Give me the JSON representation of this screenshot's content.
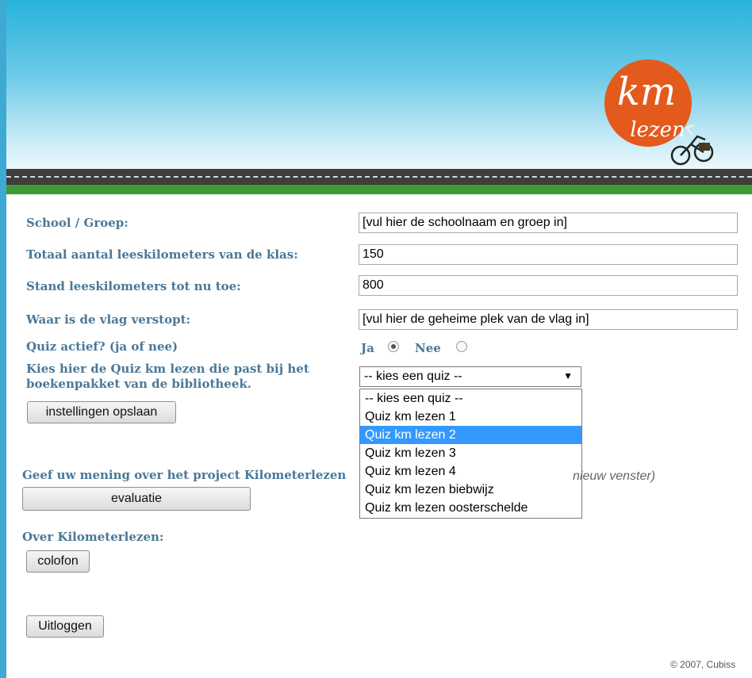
{
  "header": {
    "logo": {
      "line1": "km",
      "line2": "lezen"
    }
  },
  "form": {
    "school_label": "School / Groep:",
    "school_value": "[vul hier de schoolnaam en groep in]",
    "total_label": "Totaal aantal leeskilometers van de klas:",
    "total_value": "150",
    "stand_label": "Stand leeskilometers tot nu toe:",
    "stand_value": "800",
    "flag_label": "Waar is de vlag verstopt:",
    "flag_value": "[vul hier de geheime plek van de vlag in]",
    "quiz_active_label": "Quiz actief? (ja of nee)",
    "quiz_yes_label": "Ja",
    "quiz_no_label": "Nee",
    "quiz_active_selected": "Ja",
    "quiz_choose_label_line1": "Kies hier de Quiz km lezen die past bij het",
    "quiz_choose_label_line2": "boekenpakket van de bibliotheek.",
    "quiz_select_value": "-- kies een quiz --",
    "quiz_options": [
      "-- kies een quiz --",
      "Quiz km lezen 1",
      "Quiz km lezen 2",
      "Quiz km lezen 3",
      "Quiz km lezen 4",
      "Quiz km lezen biebwijz",
      "Quiz km lezen oosterschelde"
    ],
    "quiz_highlighted": "Quiz km lezen 2",
    "save_button": "instellingen opslaan"
  },
  "evaluation": {
    "label": "Geef uw mening over het project Kilometerlezen",
    "hint_fragment": "nieuw venster)",
    "button": "evaluatie"
  },
  "about": {
    "label": "Over Kilometerlezen:",
    "button": "colofon"
  },
  "logout_button": "Uitloggen",
  "footer": {
    "copyright": "© 2007, Cubiss"
  },
  "colors": {
    "label_text": "#4a7898",
    "highlight": "#3399ff",
    "logo_orange": "#e35a1c",
    "grass": "#3d9b35"
  }
}
